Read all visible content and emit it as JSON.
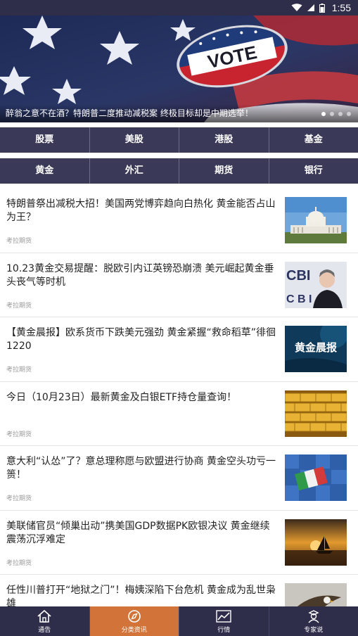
{
  "status_bar": {
    "time": "1:55",
    "icons": [
      "wifi-icon",
      "signal-icon",
      "battery-icon"
    ]
  },
  "banner": {
    "caption": "醉翁之意不在酒？特朗普二度推动减税案 终极目标却是中期选举！",
    "badge_text": "VOTE",
    "dots": 4,
    "active_dot": 0
  },
  "categories": {
    "row1": [
      "股票",
      "美股",
      "港股",
      "基金"
    ],
    "row2": [
      "黄金",
      "外汇",
      "期货",
      "银行"
    ]
  },
  "news": [
    {
      "title": "特朗普祭出减税大招！美国两党博弈趋向白热化 黄金能否占山为王？",
      "source": "考拉期货",
      "thumb": "capitol-image"
    },
    {
      "title": "10.23黄金交易提醒：脱欧引内讧英镑恐崩溃 美元崛起黄金垂头丧气等时机",
      "source": "考拉期货",
      "thumb": "politician-image"
    },
    {
      "title": "【黄金晨报】欧系货币下跌美元强劲 黄金紧握“救命稻草”徘徊1220",
      "source": "考拉期货",
      "thumb": "gold-morning-report-image",
      "thumb_text": "黄金晨报"
    },
    {
      "title": "今日（10月23日）最新黄金及白银ETF持仓量查询！",
      "source": "考拉期货",
      "thumb": "gold-bars-image"
    },
    {
      "title": "意大利“认怂”了？意总理称愿与欧盟进行协商 黄金空头功亏一篑！",
      "source": "考拉期货",
      "thumb": "puzzle-flag-image"
    },
    {
      "title": "美联储官员“倾巢出动”携美国GDP数据PK欧银决议 黄金继续震荡沉浮难定",
      "source": "考拉期货",
      "thumb": "sunset-sailboat-image"
    },
    {
      "title": "任性川普打开“地狱之门”！梅姨深陷下台危机 黄金成为乱世枭雄",
      "source": "",
      "thumb": "eagle-image"
    }
  ],
  "bottom_nav": [
    {
      "label": "通告",
      "icon": "home-icon",
      "active": false
    },
    {
      "label": "分类资讯",
      "icon": "compass-icon",
      "active": true
    },
    {
      "label": "行情",
      "icon": "chart-icon",
      "active": false
    },
    {
      "label": "专家说",
      "icon": "expert-icon",
      "active": false
    }
  ],
  "colors": {
    "nav_bg": "#2e2d4a",
    "category_bg": "#3a3a58",
    "active_tab": "#d2743a"
  }
}
